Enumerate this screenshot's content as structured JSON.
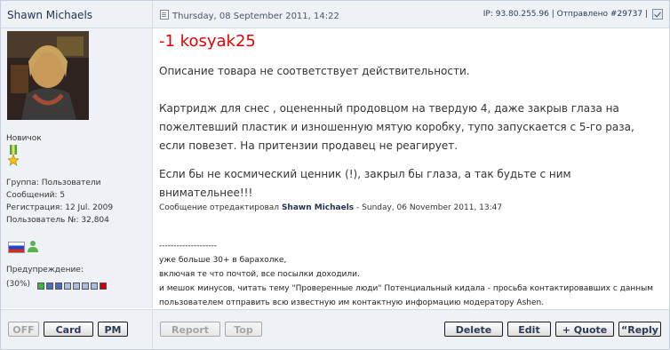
{
  "post": {
    "author": "Shawn Michaels",
    "date": "Thursday, 08 September 2011, 14:22",
    "ip": "IP: 93.80.255.96",
    "sent_label": "Отправлено",
    "post_number": "#29737",
    "title": "-1 kosyak25",
    "paragraphs": [
      "Описание товара не соответствует действительности.",
      "Картридж для снес , оцененный продовцом на твердую 4, даже закрыв глаза на пожелтевший пластик и изношенную мятую коробку, тупо запускается с 5-го раза, если повезет. На притензии продавец не реагирует.",
      "Если бы не космический ценник (!), закрыл бы глаза, а так будьте с ним внимательнее!!!"
    ],
    "edited_prefix": "Сообщение отредактировал",
    "edited_by": "Shawn Michaels",
    "edited_date": "- Sunday, 06 November 2011, 13:47",
    "signature": [
      "--------------------",
      "уже больше 30+ в барахолке,",
      "включая те что почтой, все посылки доходили.",
      "и мешок минусов, читать тему \"Проверенные люди\" Потенциальный кидала - просьба контактировавших с данным пользователем отправить всю известную им контактную информацию модератору Ashen."
    ]
  },
  "user": {
    "rank": "Новичок",
    "group": "Группа: Пользователи",
    "posts": "Сообщений: 5",
    "registered": "Регистрация: 12 Jul. 2009",
    "user_id": "Пользователь №: 32,804",
    "warning_label": "Предупреждение:",
    "warning_value": "(30%)",
    "warning_level": 0.3
  },
  "buttons": {
    "off": "OFF",
    "card": "Card",
    "pm": "PM",
    "report": "Report",
    "top": "Top",
    "delete": "Delete",
    "edit": "Edit",
    "quote": "+ Quote",
    "reply": "Reply"
  },
  "icons": {
    "post_icon": "document-icon",
    "medal": "medal-star-icon",
    "flag": "russia-flag-icon",
    "user_online": "user-icon",
    "quote_mark": "quote-icon",
    "select": "checkbox-icon"
  },
  "colors": {
    "title_red": "#e60000",
    "header_bg": "#eef1f6",
    "warning_active": "#3cb44b",
    "warning_mid": "#4a6fb5",
    "warning_idle": "#a9bce0",
    "warning_end": "#cc0000"
  }
}
